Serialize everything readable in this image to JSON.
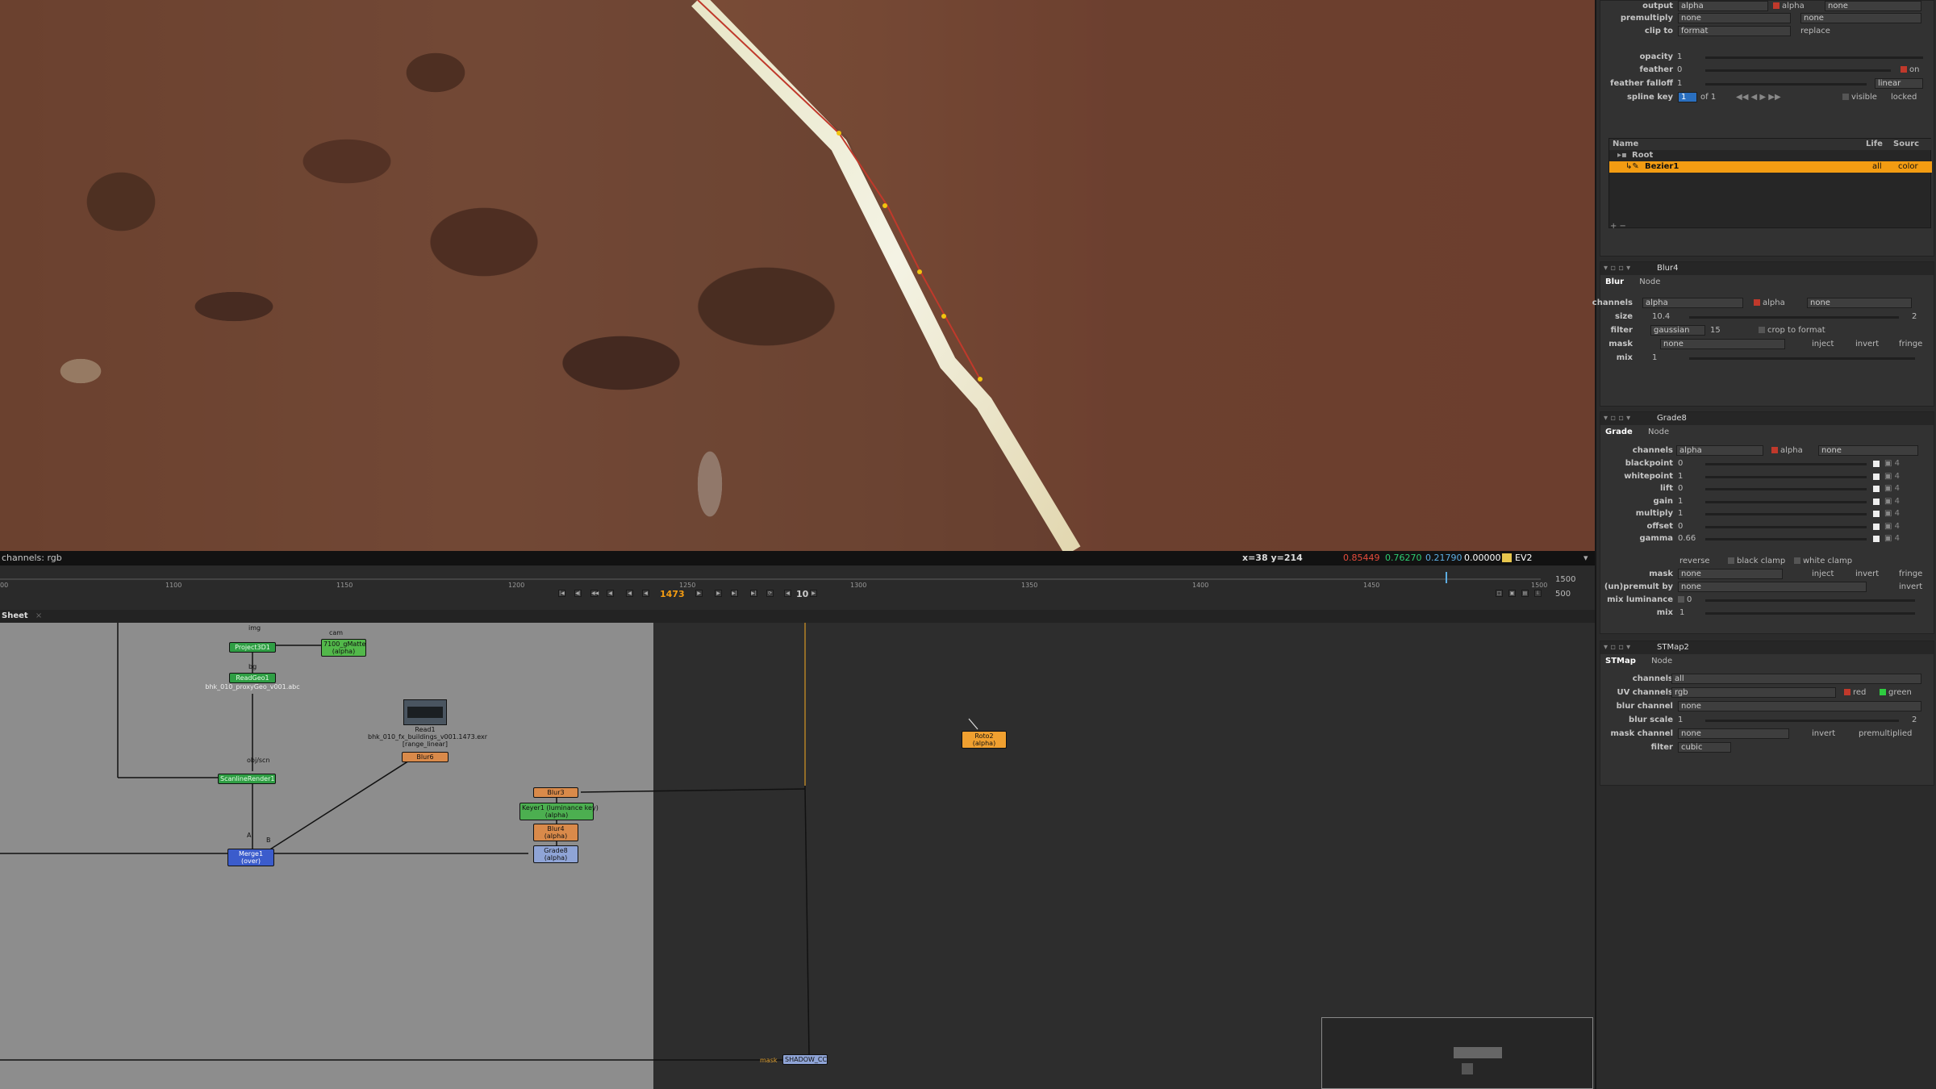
{
  "viewer": {
    "status": {
      "channels": "channels: rgb",
      "coords": "x=38 y=214",
      "r": "0.85449",
      "g": "0.76270",
      "b": "0.21790",
      "a": "0.00000",
      "ev": "EV2"
    }
  },
  "timeline": {
    "ticks": [
      "00",
      "1100",
      "1150",
      "1200",
      "1250",
      "1300",
      "1350",
      "1400",
      "1450",
      "1500"
    ],
    "end_frame": "1500",
    "current_frame": "1473",
    "step": "10",
    "range_end": "500"
  },
  "nodegraph": {
    "tab": "Sheet",
    "nodes": {
      "project3d": "Project3D1",
      "uvmatte": "7100_gMatte\n(alpha)",
      "readgeo_title": "ReadGeo1",
      "readgeo_file": "bhk_010_proxyGeo_v001.abc",
      "read_title": "Read1",
      "read_file": "bhk_010_fx_buildings_v001.1473.exr\n[range_linear]",
      "blur_read": "Blur6",
      "scanline": "ScanlineRender1",
      "blur3": "Blur3",
      "keyer": "Keyer1 (luminance key)\n(alpha)",
      "blur4": "Blur4\n(alpha)",
      "grade8": "Grade8\n(alpha)",
      "roto2": "Roto2\n(alpha)",
      "stmap": "Merge1 (over)",
      "shadow": "SHADOW_CC",
      "mask_label": "mask",
      "small_in": "img",
      "small_cam": "cam",
      "small_bg": "bg",
      "small_obj": "obj/scn",
      "small_a": "A",
      "small_b": "B"
    }
  },
  "roto": {
    "output_label": "output",
    "output_value": "alpha",
    "output_alpha": "alpha",
    "output_none": "none",
    "premultiply_label": "premultiply",
    "premultiply_value": "none",
    "premultiply_none": "none",
    "clipto_label": "clip to",
    "clipto_value": "format",
    "clipto_replace": "replace",
    "opacity_label": "opacity",
    "opacity_value": "1",
    "feather_label": "feather",
    "feather_value": "0",
    "feather_on": "on",
    "falloff_label": "feather falloff",
    "falloff_value": "1",
    "falloff_mode": "linear",
    "splinekey_label": "spline key",
    "splinekey_value": "1",
    "splinekey_of": "of 1",
    "visible": "visible",
    "locked": "locked",
    "tree_header_name": "Name",
    "tree_header_life": "Life",
    "tree_header_source": "Sourc",
    "tree_root": "Root",
    "tree_bezier": "Bezier1",
    "tree_bezier_life": "all",
    "tree_bezier_source": "color"
  },
  "blur_panel": {
    "title": "Blur4",
    "tab_main": "Blur",
    "tab_node": "Node",
    "channels_label": "channels",
    "channels_value": "alpha",
    "channels_alpha": "alpha",
    "channels_none": "none",
    "size_label": "size",
    "size_value": "10.4",
    "size_dim": "2",
    "filter_label": "filter",
    "filter_value": "gaussian",
    "filter_quality": "15",
    "crop": "crop to format",
    "mask_label": "mask",
    "mask_value": "none",
    "inject": "inject",
    "invert": "invert",
    "fringe": "fringe",
    "mix_label": "mix",
    "mix_value": "1"
  },
  "grade_panel": {
    "title": "Grade8",
    "tab_main": "Grade",
    "tab_node": "Node",
    "channels_label": "channels",
    "channels_value": "alpha",
    "channels_alpha": "alpha",
    "channels_none": "none",
    "params": [
      {
        "label": "blackpoint",
        "value": "0"
      },
      {
        "label": "whitepoint",
        "value": "1"
      },
      {
        "label": "lift",
        "value": "0"
      },
      {
        "label": "gain",
        "value": "1"
      },
      {
        "label": "multiply",
        "value": "1"
      },
      {
        "label": "offset",
        "value": "0"
      },
      {
        "label": "gamma",
        "value": "0.66"
      }
    ],
    "reverse": "reverse",
    "black_clamp": "black clamp",
    "white_clamp": "white clamp",
    "mask_label": "mask",
    "mask_value": "none",
    "inject": "inject",
    "invert": "invert",
    "fringe": "fringe",
    "unpremult_label": "(un)premult by",
    "unpremult_value": "none",
    "unpremult_invert": "invert",
    "mixlum_label": "mix luminance",
    "mixlum_value": "0",
    "mix_label": "mix",
    "mix_value": "1"
  },
  "stmap_panel": {
    "title": "STMap2",
    "tab_main": "STMap",
    "tab_node": "Node",
    "channels_label": "channels",
    "channels_value": "all",
    "uv_label": "UV channels",
    "uv_value": "rgb",
    "uv_red": "red",
    "uv_green": "green",
    "blurch_label": "blur channel",
    "blurch_value": "none",
    "blurscale_label": "blur scale",
    "blurscale_value": "1",
    "blurscale_dim": "2",
    "maskch_label": "mask channel",
    "maskch_value": "none",
    "maskch_invert": "invert",
    "maskch_premult": "premultiplied",
    "filter_label": "filter",
    "filter_value": "cubic"
  }
}
